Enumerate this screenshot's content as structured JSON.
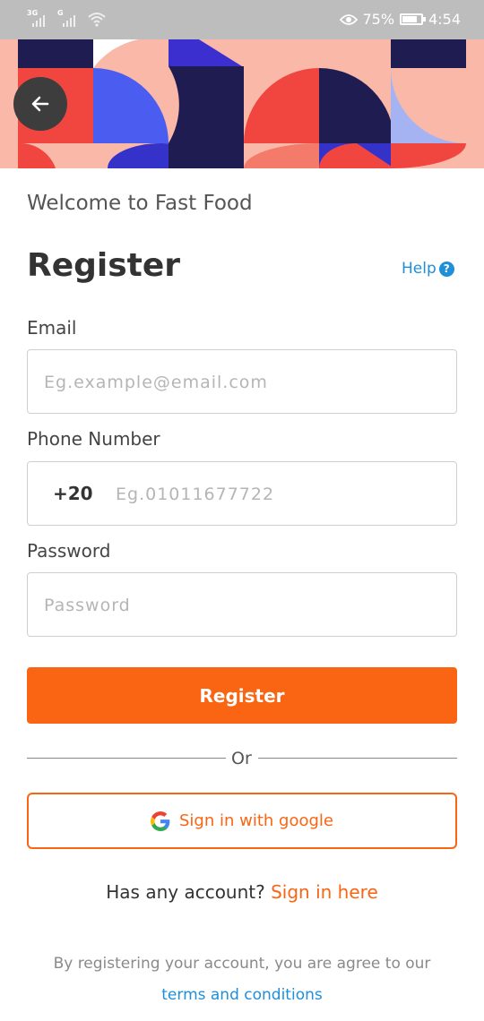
{
  "status_bar": {
    "network_tag_1": "3G",
    "network_tag_2": "G",
    "battery_percent": "75%",
    "time": "4:54",
    "battery_level": 0.75
  },
  "header": {
    "back_icon": "arrow-left-icon"
  },
  "welcome_text": "Welcome to Fast Food",
  "title": "Register",
  "help": {
    "label": "Help",
    "icon_text": "?"
  },
  "form": {
    "email_label": "Email",
    "email_placeholder": "Eg.example@email.com",
    "phone_label": "Phone Number",
    "country_code": "+20",
    "phone_placeholder": "Eg.01011677722",
    "password_label": "Password",
    "password_placeholder": "Password"
  },
  "register_button": "Register",
  "divider_text": "Or",
  "google_button": {
    "label": "Sign in with google",
    "icon": "google-icon"
  },
  "account": {
    "prompt": "Has any account?",
    "link": "Sign in here"
  },
  "footer": {
    "line1": "By registering your account, you are agree to our",
    "terms_link": "terms and conditions"
  },
  "colors": {
    "accent": "#fa6514",
    "link_blue": "#1e8fd8",
    "banner_pink": "#f9b8a8",
    "banner_navy": "#1f1c52",
    "banner_red": "#f0463f",
    "banner_blue": "#4b5cf0"
  }
}
